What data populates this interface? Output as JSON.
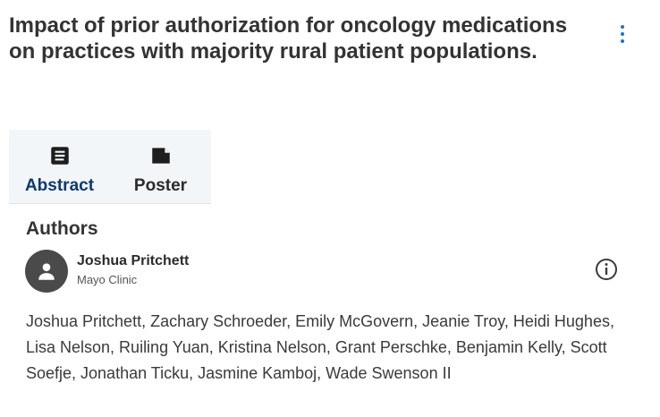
{
  "header": {
    "title": "Impact of prior authorization for oncology medications on practices with majority rural patient populations."
  },
  "tabs": [
    {
      "label": "Abstract",
      "icon": "document-icon",
      "active": true
    },
    {
      "label": "Poster",
      "icon": "note-icon",
      "active": false
    }
  ],
  "authors_section": {
    "heading": "Authors",
    "presenter": {
      "name": "Joshua Pritchett",
      "affiliation": "Mayo Clinic"
    },
    "all_authors": "Joshua Pritchett, Zachary Schroeder, Emily McGovern, Jeanie Troy, Heidi Hughes, Lisa Nelson, Ruiling Yuan, Kristina Nelson, Grant Perschke, Benjamin Kelly, Scott Soefje, Jonathan Ticku, Jasmine Kamboj, Wade Swenson II"
  },
  "colors": {
    "accent": "#1a73c9",
    "active_tab_text": "#0d3a6e",
    "tab_bg": "#f3f6f9",
    "avatar_bg": "#4a4a4a"
  }
}
